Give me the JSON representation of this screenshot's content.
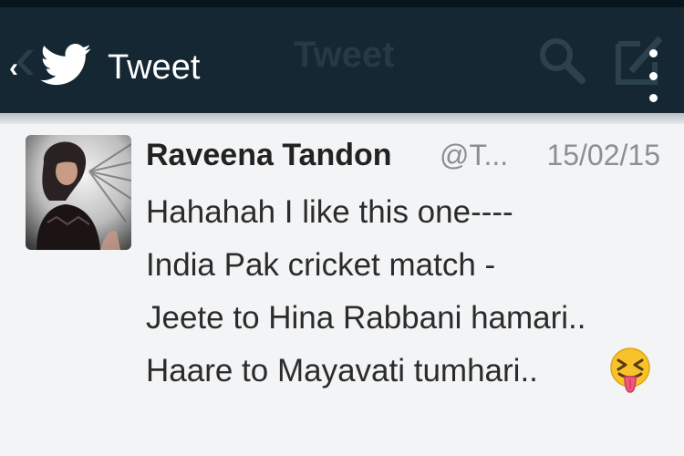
{
  "header": {
    "title": "Tweet",
    "ghost_title": "Tweet",
    "back_glyph": "‹",
    "icons": [
      "back-icon",
      "twitter-bird-icon",
      "search-icon",
      "compose-icon",
      "overflow-menu-icon"
    ]
  },
  "colors": {
    "actionbar": "#142733",
    "accent": "#ffffff",
    "name": "#222222",
    "meta": "#8a8f94"
  },
  "tweet": {
    "author_name": "Raveena Tandon",
    "handle": "@T...",
    "date": "15/02/15",
    "lines": [
      "Hahahah I like this one----",
      "India Pak cricket match -",
      "Jeete to Hina Rabbani hamari..",
      "Haare to Mayavati tumhari.."
    ],
    "emoji": "tongue-out-winking-emoji"
  }
}
